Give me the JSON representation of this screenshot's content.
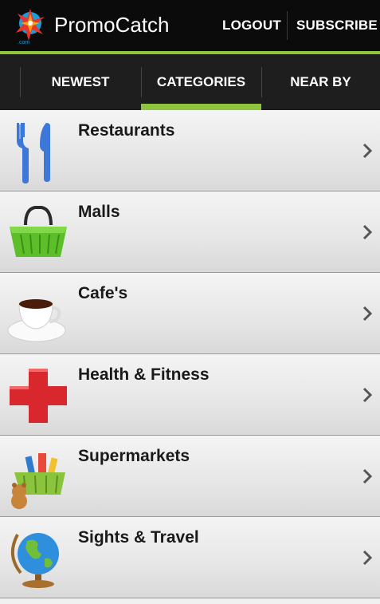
{
  "app": {
    "title": "PromoCatch",
    "logo_icon": "promocatch-logo-icon",
    "logo_caption": ".com"
  },
  "actions": {
    "logout_label": "LOGOUT",
    "subscribe_label": "SUBSCRIBE"
  },
  "tabs": [
    {
      "label": "NEWEST",
      "selected": false
    },
    {
      "label": "CATEGORIES",
      "selected": true
    },
    {
      "label": "NEAR BY",
      "selected": false
    }
  ],
  "categories": [
    {
      "label": "Restaurants",
      "icon": "fork-knife-icon"
    },
    {
      "label": "Malls",
      "icon": "shopping-basket-icon"
    },
    {
      "label": "Cafe's",
      "icon": "coffee-cup-icon"
    },
    {
      "label": "Health & Fitness",
      "icon": "red-cross-icon"
    },
    {
      "label": "Supermarkets",
      "icon": "grocery-basket-icon"
    },
    {
      "label": "Sights & Travel",
      "icon": "globe-icon"
    }
  ],
  "colors": {
    "accent": "#8fc43e",
    "actionbar": "#0b0b0b",
    "tabbar": "#1e1e1e"
  }
}
